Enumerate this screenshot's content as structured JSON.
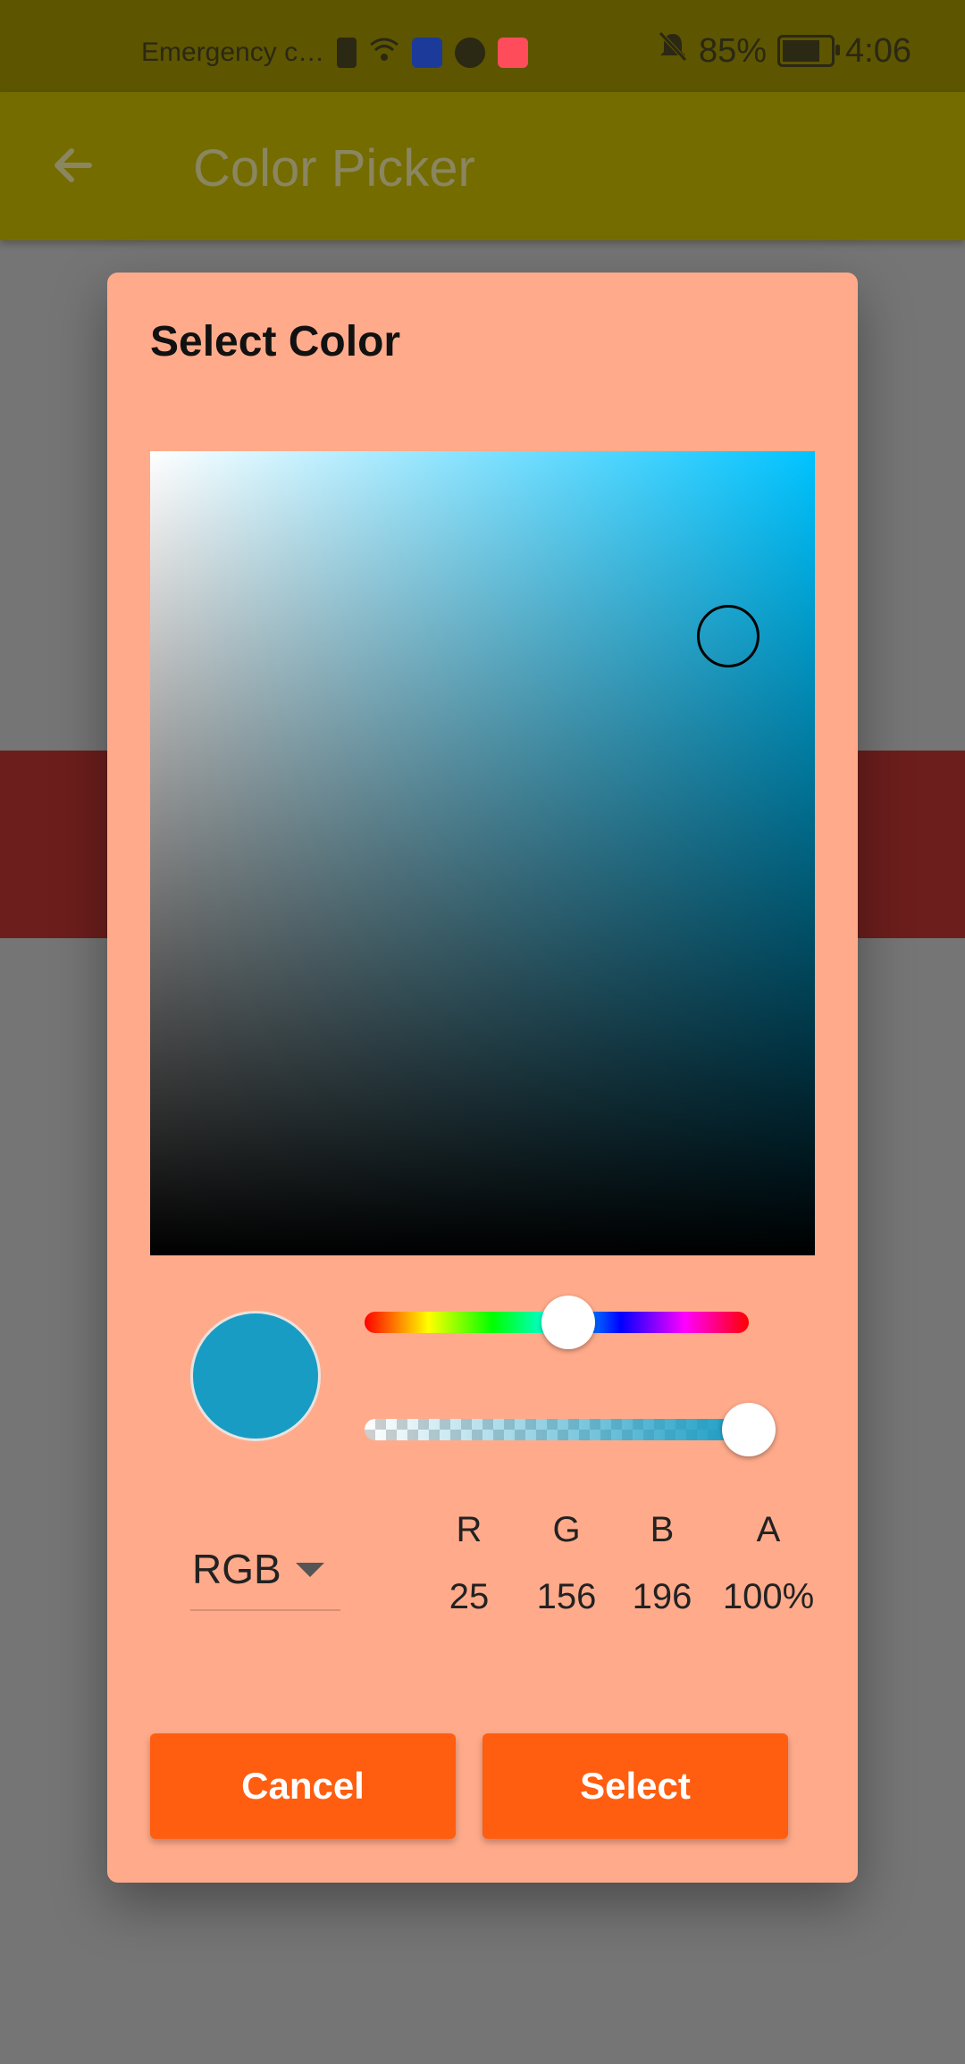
{
  "status_bar": {
    "carrier": "Emergency c…",
    "battery": "85%",
    "battery_level": 0.85,
    "time": "4:06",
    "icons": [
      "alert-icon",
      "wifi-icon",
      "app-icon",
      "vpn-icon",
      "huawei-icon",
      "bell-off-icon",
      "battery-icon"
    ]
  },
  "app_bar": {
    "title": "Color Picker",
    "back_icon": "arrow-left-icon"
  },
  "dialog": {
    "title": "Select Color",
    "picker": {
      "hue_color": "#00c3ff",
      "saturation": 0.87,
      "value": 0.77,
      "hue_position": 0.53,
      "alpha_position": 1.0
    },
    "preview_color": "#199cc4",
    "mode": "RGB",
    "channels": [
      {
        "label": "R",
        "value": "25"
      },
      {
        "label": "G",
        "value": "156"
      },
      {
        "label": "B",
        "value": "196"
      },
      {
        "label": "A",
        "value": "100%"
      }
    ],
    "buttons": {
      "cancel": "Cancel",
      "select": "Select"
    }
  },
  "colors": {
    "status_bar": "#5d5500",
    "app_bar": "#756c00",
    "dialog_bg": "#ffab8b",
    "button": "#ff5d0f",
    "background_band": "#6c1e1c"
  }
}
